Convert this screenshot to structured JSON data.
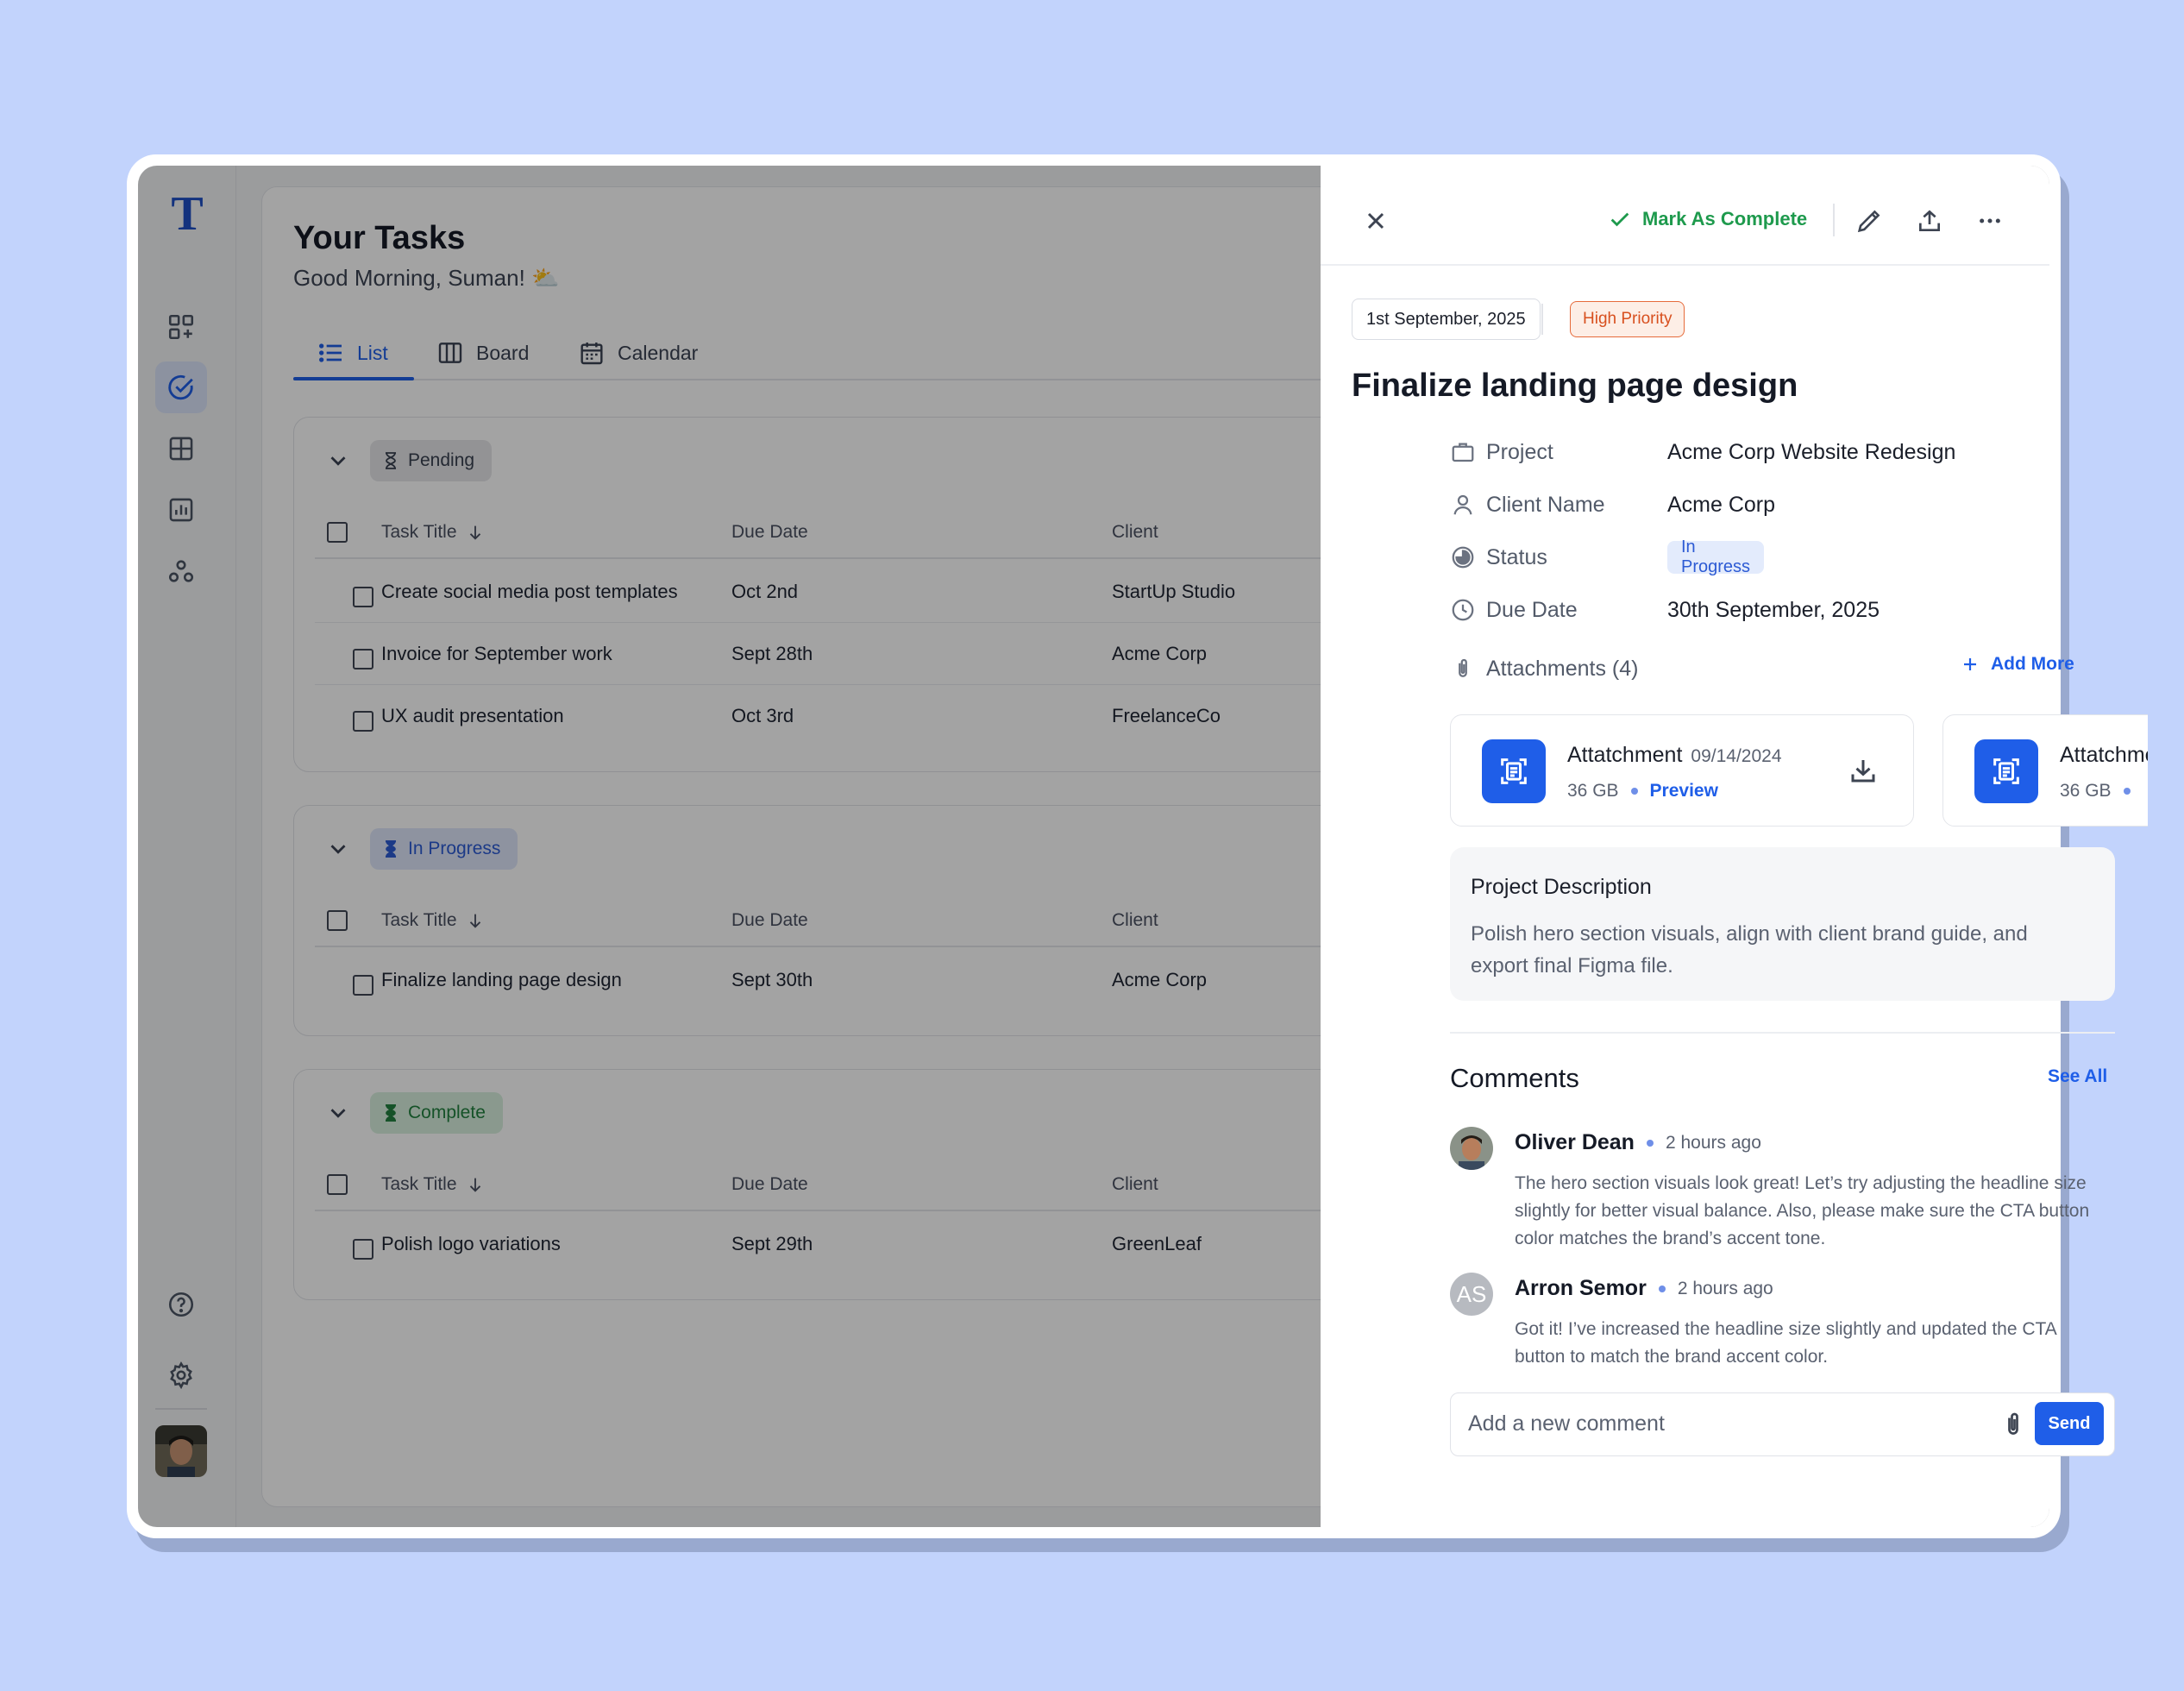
{
  "app": {
    "logo_letter": "T",
    "accent_color": "#1f5ee8",
    "sidebar": {
      "items": [
        {
          "icon": "dashboard-add-icon"
        },
        {
          "icon": "tasks-check-icon",
          "active": true
        },
        {
          "icon": "grid-icon"
        },
        {
          "icon": "report-chart-icon"
        },
        {
          "icon": "team-icon"
        }
      ],
      "bottom_items": [
        {
          "icon": "help-icon"
        },
        {
          "icon": "settings-gear-icon"
        }
      ]
    }
  },
  "main": {
    "title": "Your Tasks",
    "greeting": "Good Morning, Suman! ⛅",
    "tabs": [
      {
        "label": "List",
        "icon": "list-icon",
        "active": true
      },
      {
        "label": "Board",
        "icon": "board-columns-icon"
      },
      {
        "label": "Calendar",
        "icon": "calendar-icon"
      }
    ],
    "columns": {
      "title": "Task Title",
      "due": "Due Date",
      "client": "Client"
    },
    "groups": [
      {
        "status": "Pending",
        "tasks": [
          {
            "title": "Create social media post templates",
            "due": "Oct 2nd",
            "client": "StartUp Studio"
          },
          {
            "title": "Invoice for September work",
            "due": "Sept 28th",
            "client": "Acme Corp"
          },
          {
            "title": "UX audit presentation",
            "due": "Oct 3rd",
            "client": "FreelanceCo"
          }
        ]
      },
      {
        "status": "In Progress",
        "tasks": [
          {
            "title": "Finalize landing page design",
            "due": "Sept 30th",
            "client": "Acme Corp"
          }
        ]
      },
      {
        "status": "Complete",
        "tasks": [
          {
            "title": "Polish logo variations",
            "due": "Sept 29th",
            "client": "GreenLeaf"
          }
        ]
      }
    ]
  },
  "panel": {
    "mark_complete_label": "Mark As Complete",
    "date_chip": "1st September, 2025",
    "priority": "High Priority",
    "task_title": "Finalize landing page design",
    "properties": {
      "project_label": "Project",
      "project_value": "Acme Corp Website Redesign",
      "client_label": "Client Name",
      "client_value": "Acme Corp",
      "status_label": "Status",
      "status_value": "In Progress",
      "due_label": "Due Date",
      "due_value": "30th September, 2025"
    },
    "attachments_label": "Attachments (4)",
    "add_more": "Add More",
    "attachments": [
      {
        "name": "Attatchment",
        "date": "09/14/2024",
        "size": "36 GB",
        "preview": "Preview"
      },
      {
        "name": "Attatchment",
        "size": "36 GB"
      }
    ],
    "description": {
      "title": "Project Description",
      "text": "Polish hero section visuals, align with client brand guide, and export final Figma file."
    },
    "comments_title": "Comments",
    "see_all": "See All",
    "comments": [
      {
        "name": "Oliver Dean",
        "time": "2 hours ago",
        "text": "The hero section visuals look great! Let’s try adjusting the headline size slightly for better visual balance. Also, please make sure the CTA button color matches the brand’s accent tone."
      },
      {
        "name": "Arron Semor",
        "initials": "AS",
        "time": "2 hours ago",
        "text": "Got it! I’ve increased the headline size slightly and updated the CTA button to match the brand accent color."
      }
    ],
    "comment_placeholder": "Add a new comment",
    "send_label": "Send"
  }
}
